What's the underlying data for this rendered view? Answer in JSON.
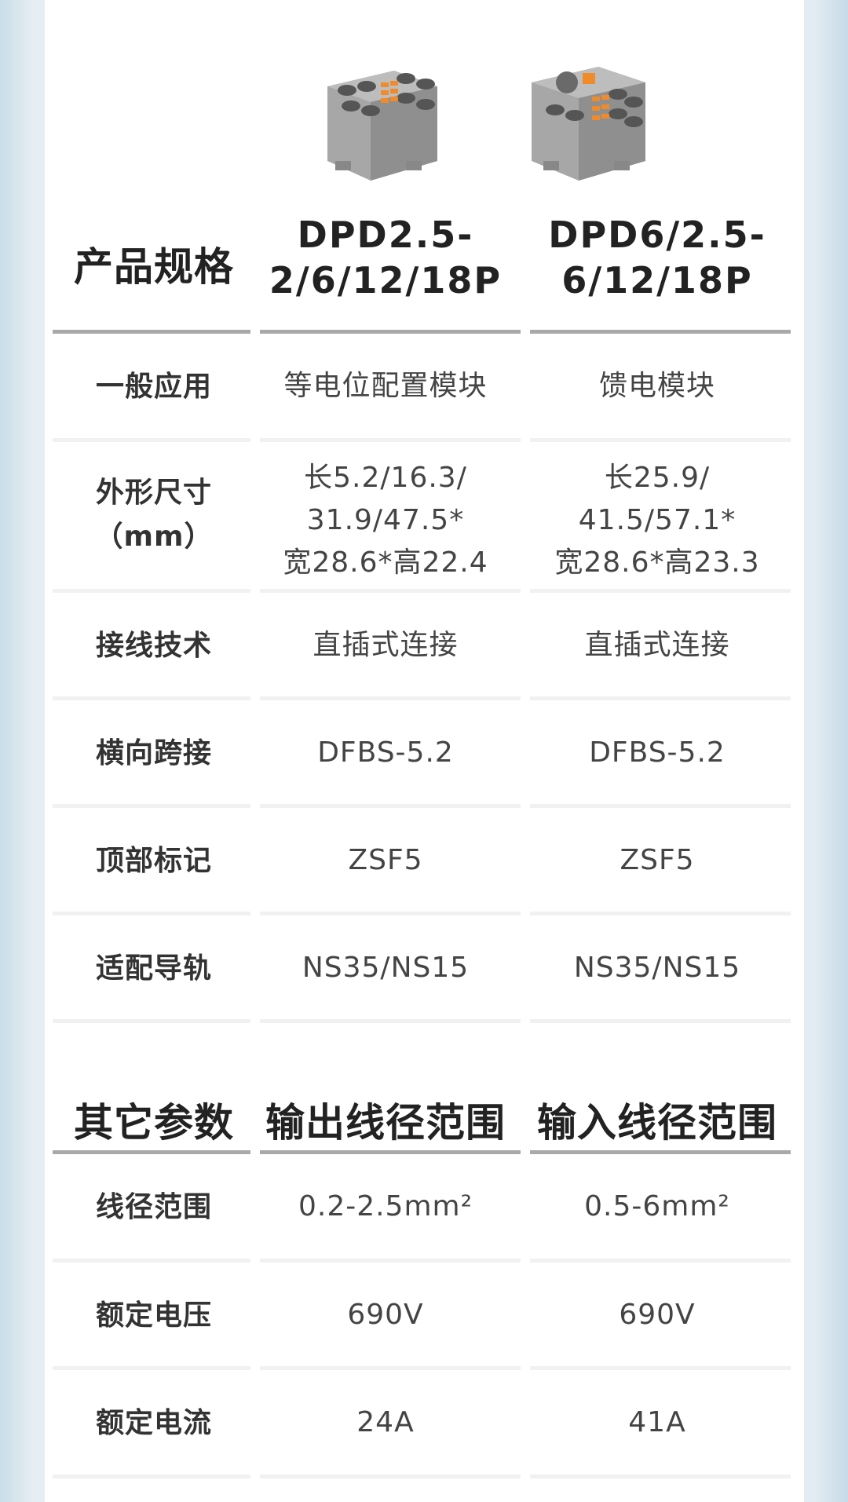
{
  "colors": {
    "panel": "#ffffff",
    "divider_dark": "#a9a9a9",
    "divider_light": "#f1f1f1",
    "accent_orange": "#f08a2a",
    "module_grey": "#a0a0a0"
  },
  "spec_table": {
    "header_label": "产品规格",
    "columns": [
      {
        "model_line1": "DPD2.5-",
        "model_line2": "2/6/12/18P",
        "image_icon": "terminal-block-dpd2.5"
      },
      {
        "model_line1": "DPD6/2.5-",
        "model_line2": "6/12/18P",
        "image_icon": "terminal-block-dpd6"
      }
    ],
    "rows": [
      {
        "label": "一般应用",
        "a": "等电位配置模块",
        "b": "馈电模块"
      },
      {
        "label_line1": "外形尺寸",
        "label_line2": "（mm）",
        "a_line1": "长5.2/16.3/",
        "a_line2": "31.9/47.5*",
        "a_line3": "宽28.6*高22.4",
        "b_line1": "长25.9/",
        "b_line2": "41.5/57.1*",
        "b_line3": "宽28.6*高23.3"
      },
      {
        "label": "接线技术",
        "a": "直插式连接",
        "b": "直插式连接"
      },
      {
        "label": "横向跨接",
        "a": "DFBS-5.2",
        "b": "DFBS-5.2"
      },
      {
        "label": "顶部标记",
        "a": "ZSF5",
        "b": "ZSF5"
      },
      {
        "label": "适配导轨",
        "a": "NS35/NS15",
        "b": "NS35/NS15"
      }
    ]
  },
  "other_table": {
    "header_label": "其它参数",
    "col_a_header": "输出线径范围",
    "col_b_header": "输入线径范围",
    "rows": [
      {
        "label": "线径范围",
        "a": "0.2-2.5mm²",
        "b": "0.5-6mm²"
      },
      {
        "label": "额定电压",
        "a": "690V",
        "b": "690V"
      },
      {
        "label": "额定电流",
        "a": "24A",
        "b": "41A"
      }
    ]
  }
}
